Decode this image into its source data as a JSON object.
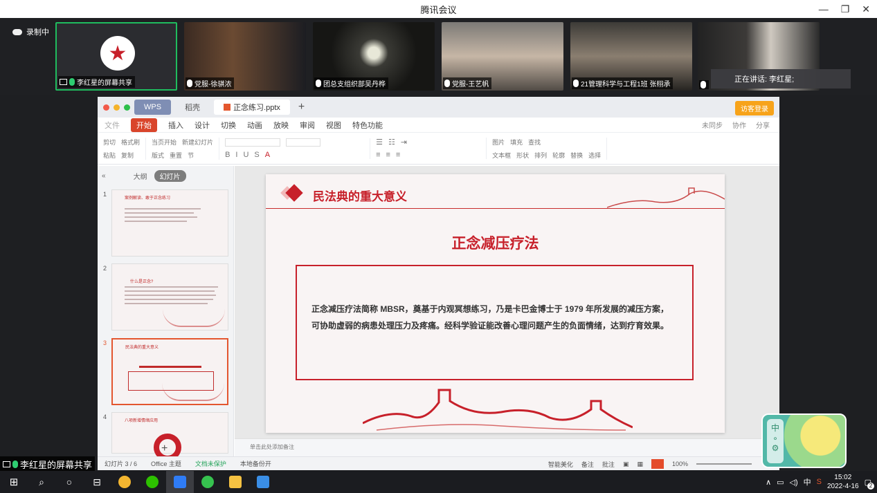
{
  "meeting": {
    "title": "腾讯会议",
    "recording": "录制中",
    "tiles": [
      {
        "name": "李红星的屏幕共享"
      },
      {
        "name": "党服-徐骐浓"
      },
      {
        "name": "团总支组织部吴丹桦"
      },
      {
        "name": "党服-王艺帆"
      },
      {
        "name": "21管理科学与工程1班 张栩承"
      }
    ],
    "speaking": "正在讲话: 李红星;"
  },
  "wps": {
    "tabs": [
      "WPS",
      "稻壳",
      "正念练习.pptx"
    ],
    "visitor_login": "访客登录",
    "menu": [
      "文件",
      "开始",
      "插入",
      "设计",
      "切换",
      "动画",
      "放映",
      "审阅",
      "视图",
      "特色功能"
    ],
    "menu_right": [
      "未同步",
      "协作",
      "分享"
    ],
    "ribbon": {
      "row1": [
        "剪切",
        "格式刷",
        "当页开始",
        "新建幻灯片",
        "版式",
        "重置",
        "图片",
        "填充",
        "查找"
      ],
      "row2": [
        "粘贴",
        "复制",
        "节",
        "文本框",
        "形状",
        "排列",
        "轮廓",
        "替换",
        "选择"
      ]
    },
    "panel": {
      "outline": "大纲",
      "slides": "幻灯片"
    },
    "thumbs": [
      {
        "num": "1",
        "title": "案例解读、敢于正念练习"
      },
      {
        "num": "2",
        "title": "什么是正念?"
      },
      {
        "num": "3",
        "title": "民法典的重大意义"
      },
      {
        "num": "4",
        "title": "八项新增情绪应用"
      }
    ],
    "slide": {
      "header": "民法典的重大意义",
      "subtitle": "正念减压疗法",
      "body": "正念减压疗法简称 MBSR，奠基于内观冥想练习，乃是卡巴金博士于 1979 年所发展的减压方案，可协助虚弱的病患处理压力及疼痛。经科学验证能改善心理问题产生的负面情绪，达到疗育效果。"
    },
    "notes": "单击此处添加备注",
    "status": {
      "slide_counter": "幻灯片 3 / 6",
      "theme": "Office 主题",
      "protect": "文档未保护",
      "backup": "本地备份开",
      "smart": "智能美化",
      "remark": "备注",
      "comment": "批注",
      "zoom": "100%"
    }
  },
  "share_label": "李红星的屏幕共享",
  "lemon_widget": {
    "label": "中"
  },
  "taskbar": {
    "time": "15:02",
    "date": "2022-4-16",
    "ime": "中",
    "notif_count": "2"
  }
}
